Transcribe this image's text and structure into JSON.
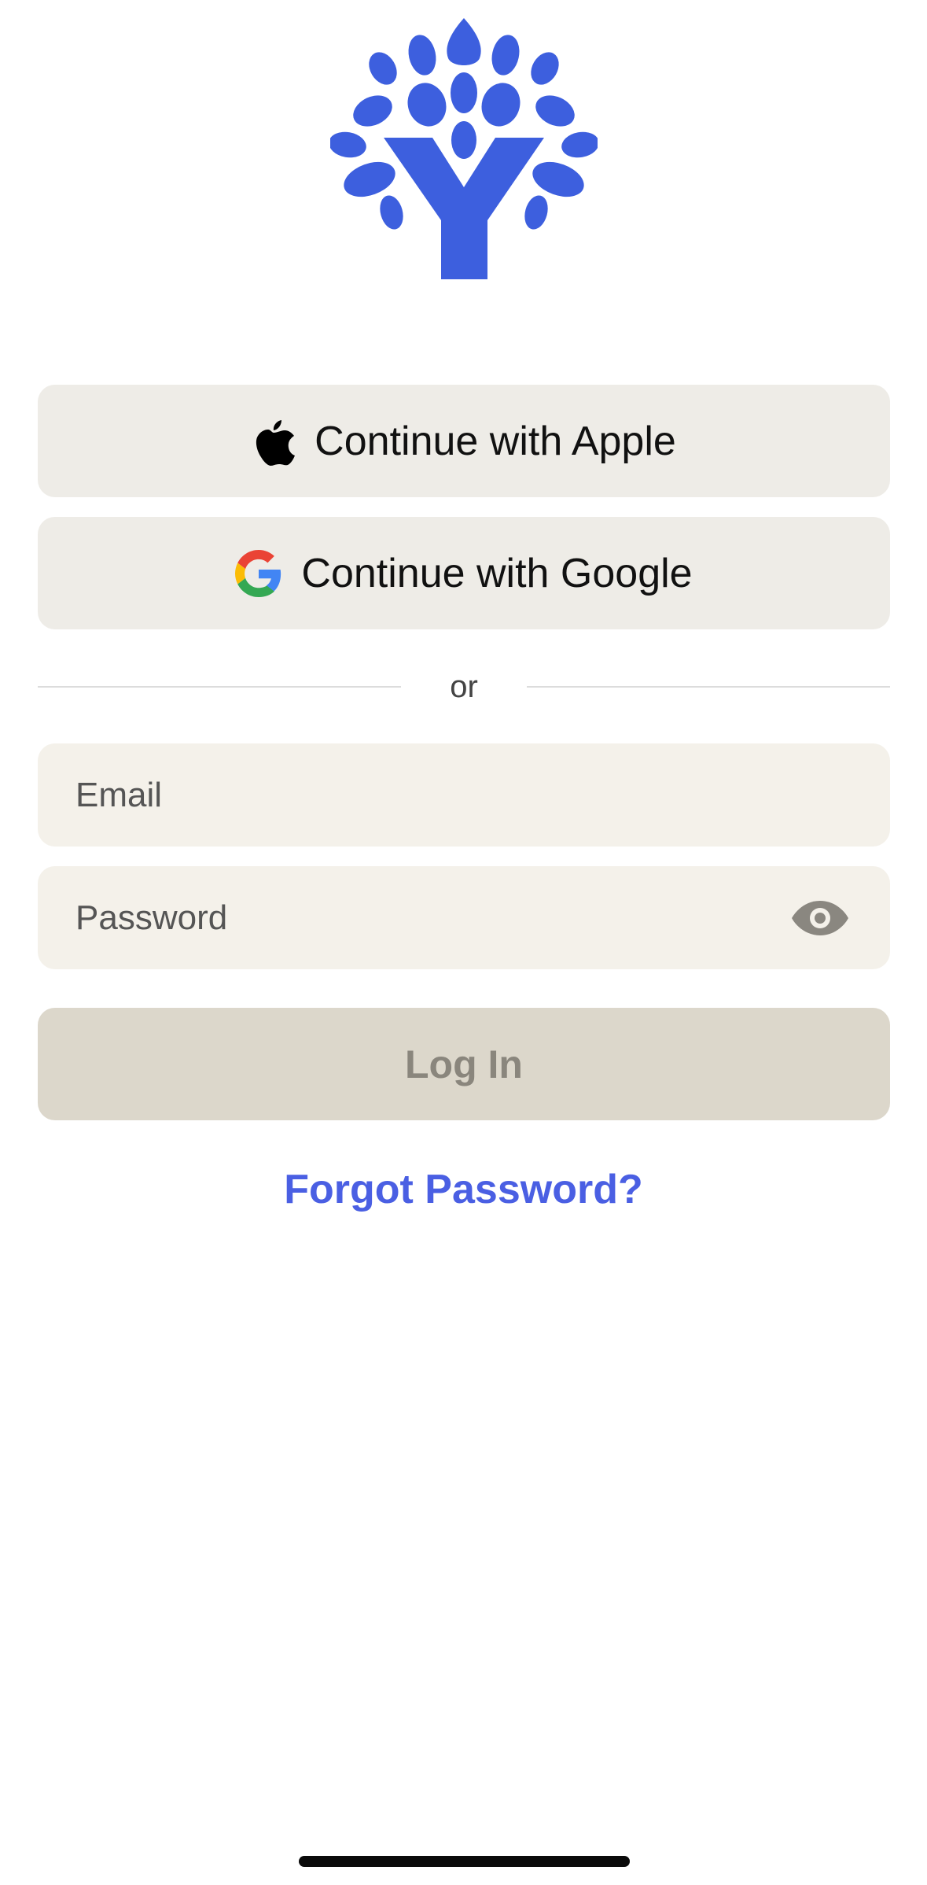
{
  "colors": {
    "brand": "#3d5fde",
    "link": "#4a5fe3",
    "social_button_bg": "#eeece7",
    "field_bg": "#f4f1ea",
    "login_disabled_bg": "#dcd7cb"
  },
  "logo": {
    "icon": "tree-logo-icon"
  },
  "social": {
    "apple_label": "Continue with Apple",
    "apple_icon": "apple-icon",
    "google_label": "Continue with Google",
    "google_icon": "google-icon"
  },
  "divider": {
    "text": "or"
  },
  "form": {
    "email_placeholder": "Email",
    "email_value": "",
    "password_placeholder": "Password",
    "password_value": "",
    "password_toggle_icon": "eye-icon",
    "login_label": "Log In",
    "forgot_label": "Forgot Password?"
  }
}
